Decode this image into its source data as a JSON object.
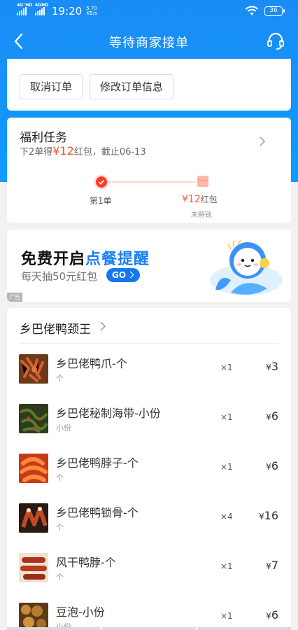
{
  "status_bar": {
    "network1": "4G⁺HD",
    "network2": "4GHD",
    "time": "19:20",
    "speed_value": "5.70",
    "speed_unit": "KB/s",
    "battery": "36"
  },
  "nav": {
    "title": "等待商家接单",
    "back_icon": "chevron-left-icon",
    "service_icon": "headset-icon"
  },
  "actions": {
    "cancel_label": "取消订单",
    "modify_label": "修改订单信息"
  },
  "welfare": {
    "title": "福利任务",
    "subtitle_prefix": "下2单得",
    "subtitle_amount": "¥12",
    "subtitle_suffix": "红包，截止06-13",
    "step1_label": "第1单",
    "reward_amount": "¥12",
    "reward_unit": "红包",
    "reward_status": "未解锁"
  },
  "banner": {
    "title_prefix": "免费开启",
    "title_highlight": "点餐提醒",
    "subtitle": "每天抽50元红包",
    "go_label": "GO",
    "ad_tag": "广告"
  },
  "shop": {
    "name": "乡巴佬鸭颈王",
    "items": [
      {
        "name": "乡巴佬鸭爪-个",
        "spec": "个",
        "qty": "×1",
        "yen": "¥",
        "price": "3"
      },
      {
        "name": "乡巴佬秘制海带-小份",
        "spec": "小份",
        "qty": "×1",
        "yen": "¥",
        "price": "6"
      },
      {
        "name": "乡巴佬鸭脖子-个",
        "spec": "个",
        "qty": "×1",
        "yen": "¥",
        "price": "6"
      },
      {
        "name": "乡巴佬鸭锁骨-个",
        "spec": "个",
        "qty": "×4",
        "yen": "¥",
        "price": "16"
      },
      {
        "name": "风干鸭脖-个",
        "spec": "个",
        "qty": "×1",
        "yen": "¥",
        "price": "7"
      },
      {
        "name": "豆泡-小份",
        "spec": "小份",
        "qty": "×1",
        "yen": "¥",
        "price": "6"
      }
    ]
  },
  "colors": {
    "header_blue": "#1a8cf5",
    "accent_red": "#ff4a2e",
    "banner_blue": "#1a7ff0"
  }
}
